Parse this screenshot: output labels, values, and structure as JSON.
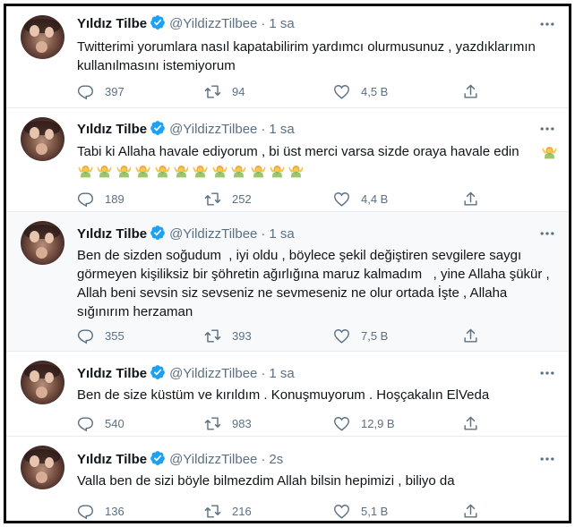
{
  "colors": {
    "verified_blue": "#1da1f2",
    "secondary_text": "#5b7083",
    "primary_text": "#0f1419",
    "separator": "#e6ecf0",
    "highlight_background": "#f7f9fa"
  },
  "icons": {
    "verified": "verified-badge-icon",
    "more": "more-horizontal-icon",
    "reply": "reply-icon",
    "retweet": "retweet-icon",
    "like": "heart-icon",
    "share": "share-icon",
    "emoji": "person-with-raised-hands-emoji"
  },
  "tweets": [
    {
      "name": "Yıldız Tilbe",
      "handle": "@YildizzTilbee",
      "separator": "·",
      "time": "1 sa",
      "text": "Twitterimi yorumlara nasıl kapatabilirim yardımcı olurmusunuz , yazdıklarımın kullanılmasını istemiyorum",
      "replies": "397",
      "retweets": "94",
      "likes": "4,5 B"
    },
    {
      "name": "Yıldız Tilbe",
      "handle": "@YildizzTilbee",
      "separator": "·",
      "time": "1 sa",
      "text": "Tabi ki Allaha havale ediyorum , bi üst merci varsa sizde oraya havale edin",
      "emoji_count": 13,
      "replies": "189",
      "retweets": "252",
      "likes": "4,4 B"
    },
    {
      "name": "Yıldız Tilbe",
      "handle": "@YildizzTilbee",
      "separator": "·",
      "time": "1 sa",
      "text": "Ben de sizden soğudum  , iyi oldu , böylece şekil değiştiren sevgilere saygı görmeyen kişiliksiz bir şöhretin ağırlığına maruz kalmadım   , yine Allaha şükür , Allah beni sevsin siz sevseniz ne sevmeseniz ne olur ortada İşte , Allaha sığınırım herzaman",
      "replies": "355",
      "retweets": "393",
      "likes": "7,5 B"
    },
    {
      "name": "Yıldız Tilbe",
      "handle": "@YildizzTilbee",
      "separator": "·",
      "time": "1 sa",
      "text": "Ben de size küstüm ve kırıldım . Konuşmuyorum . Hoşçakalın ElVeda",
      "replies": "540",
      "retweets": "983",
      "likes": "12,9 B"
    },
    {
      "name": "Yıldız Tilbe",
      "handle": "@YildizzTilbee",
      "separator": "·",
      "time": "2s",
      "text": "Valla ben de sizi böyle bilmezdim Allah bilsin hepimizi , biliyo da",
      "replies": "136",
      "retweets": "216",
      "likes": "5,1 B"
    }
  ]
}
